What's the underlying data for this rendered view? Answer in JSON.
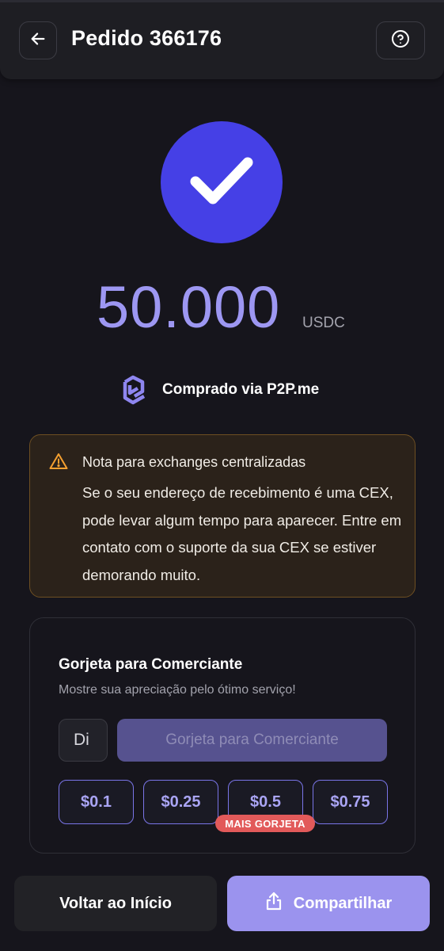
{
  "header": {
    "title": "Pedido 366176",
    "back_icon": "arrow-left-icon",
    "help_icon": "help-circle-icon"
  },
  "success": {
    "icon": "check-icon",
    "amount": "50.000",
    "currency": "USDC",
    "via_text": "Comprado via P2P.me",
    "via_logo": "p2p-logo-icon",
    "accent_color": "#4540e6"
  },
  "note": {
    "icon": "warning-triangle-icon",
    "title": "Nota para exchanges centralizadas",
    "body": "Se o seu endereço de recebimento é uma CEX, pode levar algum tempo para aparecer. Entre em contato com o suporte da sua CEX se estiver demorando muito."
  },
  "tip": {
    "title": "Gorjeta para Comerciante",
    "subtitle": "Mostre sua apreciação pelo ótimo serviço!",
    "input_placeholder": "Di",
    "submit_label": "Gorjeta para Comerciante",
    "options": [
      "$0.1",
      "$0.25",
      "$0.5",
      "$0.75"
    ],
    "badge": "MAIS GORJETA"
  },
  "actions": {
    "home_label": "Voltar ao Início",
    "share_label": "Compartilhar",
    "share_icon": "share-icon"
  }
}
